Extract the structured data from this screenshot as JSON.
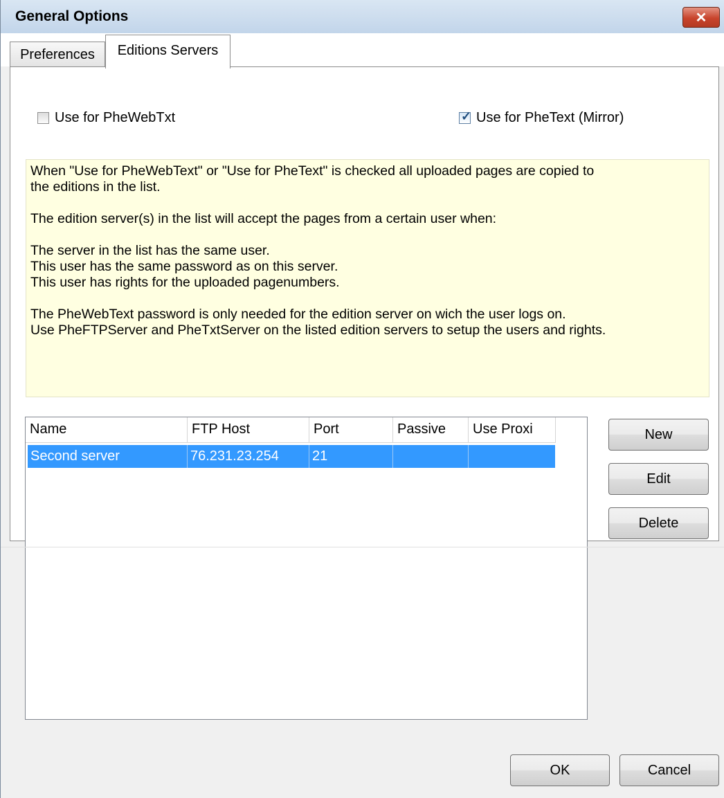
{
  "window": {
    "title": "General Options",
    "close_glyph": "✕"
  },
  "tabs": [
    {
      "label": "Preferences",
      "selected": false
    },
    {
      "label": "Editions Servers",
      "selected": true
    }
  ],
  "checkboxes": {
    "phewebtxt": {
      "label": "Use for PheWebTxt",
      "checked": false
    },
    "phetext": {
      "label": "Use for PheText (Mirror)",
      "checked": true,
      "check_glyph": "✓"
    }
  },
  "info": {
    "line1": "When \"Use for PheWebText\" or \"Use for PheText\" is checked all uploaded pages are copied to",
    "line2": "the editions in the list.",
    "line3": "The edition server(s) in the list will accept the pages from a certain user when:",
    "line4": "The server in the list has the same user.",
    "line5": "This user has the same password as on this server.",
    "line6": "This user has rights for the uploaded pagenumbers.",
    "line7": "The PheWebText password is only needed for the edition server on wich the user logs on.",
    "line8": "Use PheFTPServer and PheTxtServer on the listed edition servers to setup the users and rights."
  },
  "servers": {
    "columns": [
      "Name",
      "FTP Host",
      "Port",
      "Passive",
      "Use Proxi"
    ],
    "rows": [
      {
        "name": "Second server",
        "host": "76.231.23.254",
        "port": "21",
        "passive": "",
        "proxy": "",
        "selected": true
      }
    ]
  },
  "side_buttons": {
    "new": "New",
    "edit": "Edit",
    "delete": "Delete"
  },
  "footer": {
    "ok": "OK",
    "cancel": "Cancel"
  },
  "colors": {
    "selection": "#3399ff",
    "info_bg": "#ffffe1",
    "close_btn": "#c8442c"
  }
}
